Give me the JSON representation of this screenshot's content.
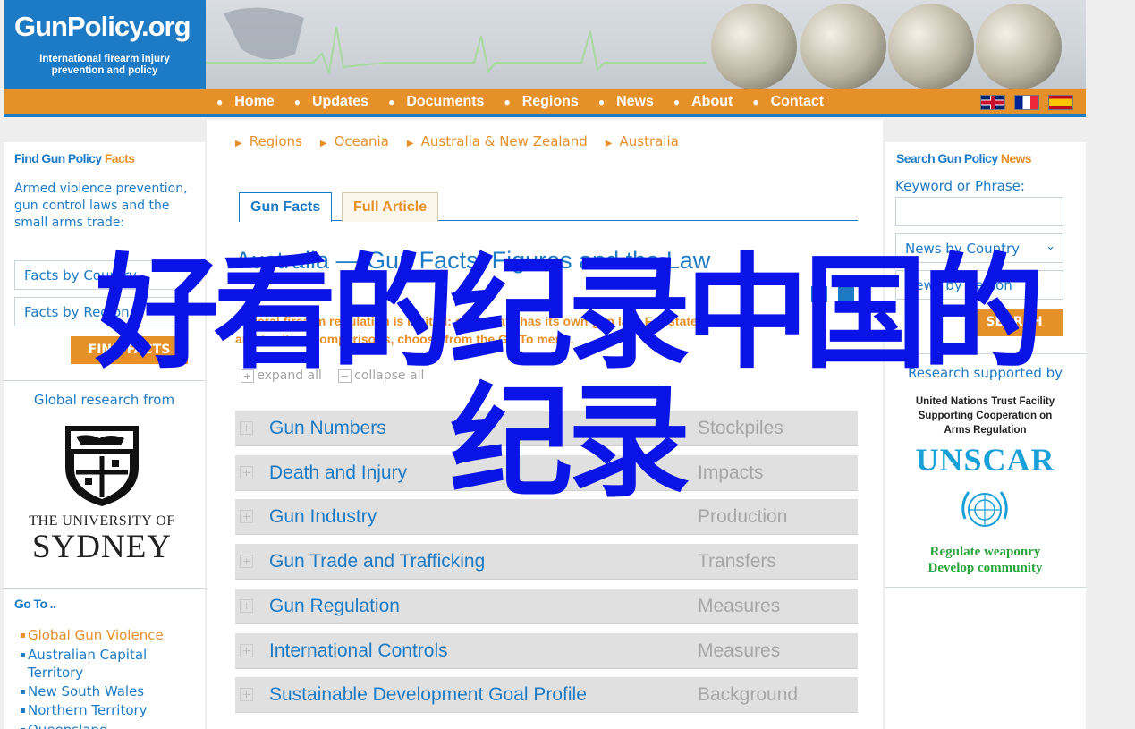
{
  "header": {
    "logo_title": "GunPolicy.org",
    "logo_sub_line1": "International firearm injury",
    "logo_sub_line2": "prevention and policy"
  },
  "nav": {
    "items": [
      "Home",
      "Updates",
      "Documents",
      "Regions",
      "News",
      "About",
      "Contact"
    ],
    "flags": [
      "uk-flag-icon",
      "france-flag-icon",
      "spain-flag-icon"
    ]
  },
  "left": {
    "title_main": "Find Gun Policy ",
    "title_accent": "Facts",
    "description": "Armed violence prevention, gun control laws and the small arms trade:",
    "select1": "Facts by Country",
    "select2": "Facts by Region",
    "button": "FIND FACTS",
    "research_from": "Global research from",
    "sydney_line1": "THE UNIVERSITY OF",
    "sydney_line2": "SYDNEY",
    "goto_title": "Go To ..",
    "goto_items": [
      "Global Gun Violence",
      "Australian Capital Territory",
      "New South Wales",
      "Northern Territory",
      "Queensland"
    ]
  },
  "main": {
    "breadcrumb": [
      "Regions",
      "Oceania",
      "Australia & New Zealand",
      "Australia"
    ],
    "tabs": [
      "Gun Facts",
      "Full Article"
    ],
    "title": "Australia — Gun Facts, Figures and the Law",
    "intro": "Federal firearm regulation is limited: each state has its own gun law. For state and territory comparisons, choose from the Go To menu.",
    "expand_all": "expand all",
    "collapse_all": "collapse all",
    "rows": [
      {
        "label": "Gun Numbers",
        "category": "Stockpiles"
      },
      {
        "label": "Death and Injury",
        "category": "Impacts"
      },
      {
        "label": "Gun Industry",
        "category": "Production"
      },
      {
        "label": "Gun Trade and Trafficking",
        "category": "Transfers"
      },
      {
        "label": "Gun Regulation",
        "category": "Measures"
      },
      {
        "label": "International Controls",
        "category": "Measures"
      },
      {
        "label": "Sustainable Development Goal Profile",
        "category": "Background"
      }
    ]
  },
  "right": {
    "title_main": "Search Gun Policy ",
    "title_accent": "News",
    "keyword_label": "Keyword or Phrase:",
    "select1": "News by Country",
    "select2": "News by Region",
    "button": "SEARCH",
    "research_supported": "Research supported by",
    "un_line1": "United Nations Trust Facility",
    "un_line2": "Supporting Cooperation on",
    "un_line3": "Arms Regulation",
    "unscar": "UNSCAR",
    "slogan1": "Regulate weaponry",
    "slogan2": "Develop community"
  },
  "watermark": {
    "line1": "好看的纪录中国的",
    "line2": "纪录"
  },
  "colors": {
    "brand_blue": "#1d7ac4",
    "brand_orange": "#e6902a",
    "watermark_blue": "#0a14e6"
  }
}
